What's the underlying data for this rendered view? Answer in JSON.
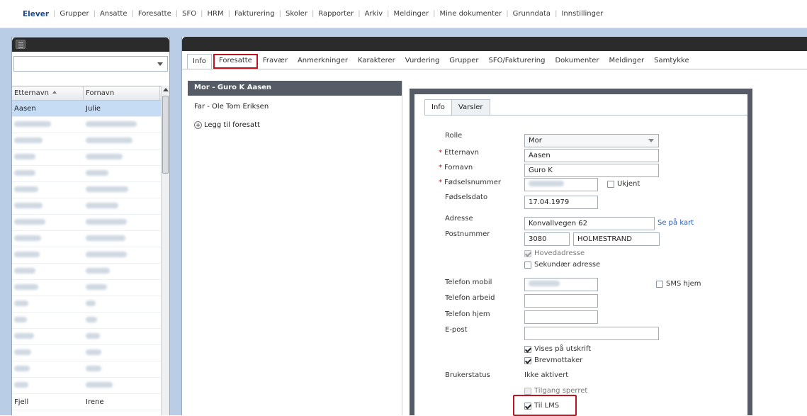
{
  "nav": {
    "items": [
      "Elever",
      "Grupper",
      "Ansatte",
      "Foresatte",
      "SFO",
      "HRM",
      "Fakturering",
      "Skoler",
      "Rapporter",
      "Arkiv",
      "Meldinger",
      "Mine dokumenter",
      "Grunndata",
      "Innstillinger"
    ],
    "active": "Elever"
  },
  "student_list": {
    "columns": [
      "Etternavn",
      "Fornavn"
    ],
    "selected_row": {
      "last": "Aasen",
      "first": "Julie"
    },
    "last_row": {
      "last": "Fjell",
      "first": "Irene"
    }
  },
  "tabs": [
    "Info",
    "Foresatte",
    "Fravær",
    "Anmerkninger",
    "Karakterer",
    "Vurdering",
    "Grupper",
    "SFO/Fakturering",
    "Dokumenter",
    "Meldinger",
    "Samtykke"
  ],
  "active_tab": "Foresatte",
  "guardians": {
    "selected": "Mor - Guro K Aasen",
    "others": [
      "Far - Ole Tom Eriksen"
    ],
    "add_label": "Legg til foresatt"
  },
  "detail": {
    "tabs": [
      "Info",
      "Varsler"
    ],
    "fields": {
      "rolle_label": "Rolle",
      "rolle_value": "Mor",
      "etternavn_label": "Etternavn",
      "etternavn_value": "Aasen",
      "fornavn_label": "Fornavn",
      "fornavn_value": "Guro K",
      "fodselsnummer_label": "Fødselsnummer",
      "ukjent_label": "Ukjent",
      "fodselsdato_label": "Fødselsdato",
      "fodselsdato_value": "17.04.1979",
      "adresse_label": "Adresse",
      "adresse_value": "Konvallvegen 62",
      "map_link": "Se på kart",
      "postnummer_label": "Postnummer",
      "postnummer_value": "3080",
      "poststed_value": "HOLMESTRAND",
      "hovedadresse_label": "Hovedadresse",
      "sekundar_label": "Sekundær adresse",
      "mobil_label": "Telefon mobil",
      "sms_label": "SMS hjem",
      "arbeid_label": "Telefon arbeid",
      "hjem_label": "Telefon hjem",
      "epost_label": "E-post",
      "vises_label": "Vises på utskrift",
      "brev_label": "Brevmottaker",
      "brukerstatus_label": "Brukerstatus",
      "brukerstatus_value": "Ikke aktivert",
      "tilgang_label": "Tilgang sperret",
      "lms_label": "Til LMS"
    }
  },
  "colors": {
    "workspace": "#b9cde6",
    "header_dark": "#2b2b2b",
    "highlight": "#c0121f",
    "selected_row": "#c6dcf5"
  }
}
